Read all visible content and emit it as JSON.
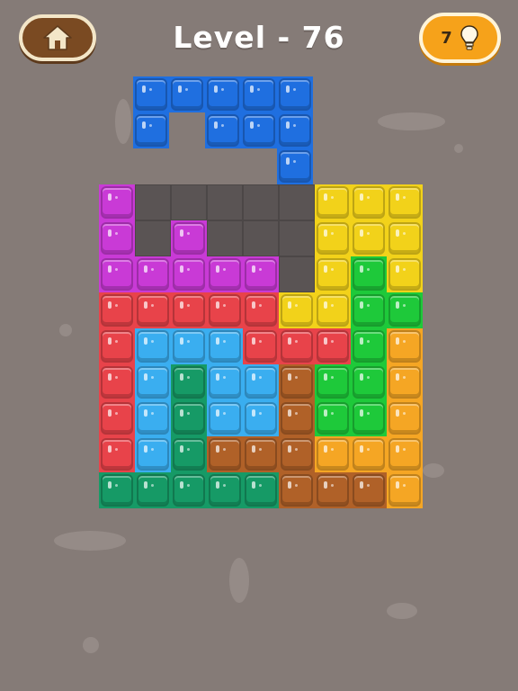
{
  "header": {
    "title": "Level - 76",
    "hint_count": "7"
  },
  "icons": {
    "home": "home-icon",
    "hint": "lightbulb-icon"
  },
  "colors": {
    "background": "#857b77",
    "empty_cell": "#5a5454",
    "purple": "#c93ad6",
    "yellow": "#f2d21a",
    "red": "#e8434a",
    "lightblue": "#3aaef0",
    "darkgreen": "#169a66",
    "brown": "#b06128",
    "green": "#1ec93a",
    "orange": "#f5a624",
    "blue": "#1f6fe0"
  },
  "board": {
    "rows": 9,
    "cols": 9,
    "cells": [
      [
        "purple",
        "empty",
        "empty",
        "empty",
        "empty",
        "empty",
        "yellow",
        "yellow",
        "yellow"
      ],
      [
        "purple",
        "empty",
        "purple",
        "empty",
        "empty",
        "empty",
        "yellow",
        "yellow",
        "yellow"
      ],
      [
        "purple",
        "purple",
        "purple",
        "purple",
        "purple",
        "empty",
        "yellow",
        "green",
        "yellow"
      ],
      [
        "red",
        "red",
        "red",
        "red",
        "red",
        "yellow",
        "yellow",
        "green",
        "green"
      ],
      [
        "red",
        "lightblue",
        "lightblue",
        "lightblue",
        "red",
        "red",
        "red",
        "green",
        "orange"
      ],
      [
        "red",
        "lightblue",
        "darkgreen",
        "lightblue",
        "lightblue",
        "brown",
        "green",
        "green",
        "orange"
      ],
      [
        "red",
        "lightblue",
        "darkgreen",
        "lightblue",
        "lightblue",
        "brown",
        "green",
        "green",
        "orange"
      ],
      [
        "red",
        "lightblue",
        "darkgreen",
        "brown",
        "brown",
        "brown",
        "orange",
        "orange",
        "orange"
      ],
      [
        "darkgreen",
        "darkgreen",
        "darkgreen",
        "darkgreen",
        "darkgreen",
        "brown",
        "brown",
        "brown",
        "orange"
      ]
    ]
  },
  "floating_piece": {
    "color": "blue",
    "cells": [
      [
        0,
        0
      ],
      [
        1,
        0
      ],
      [
        2,
        0
      ],
      [
        3,
        0
      ],
      [
        4,
        0
      ],
      [
        0,
        1
      ],
      [
        2,
        1
      ],
      [
        3,
        1
      ],
      [
        4,
        1
      ],
      [
        4,
        2
      ]
    ]
  }
}
